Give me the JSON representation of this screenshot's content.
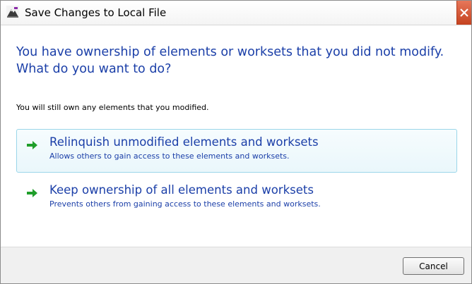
{
  "window": {
    "title": "Save Changes to Local File"
  },
  "main": {
    "instruction": "You have ownership of elements or worksets that you did not modify. What do you want to do?",
    "note": "You will still own any elements that you modified.",
    "options": [
      {
        "title": "Relinquish unmodified elements and worksets",
        "description": "Allows others to gain access to these elements and worksets."
      },
      {
        "title": "Keep ownership of all elements and worksets",
        "description": "Prevents others from gaining access to these elements and worksets."
      }
    ]
  },
  "footer": {
    "cancel_label": "Cancel"
  },
  "colors": {
    "instruction_text": "#1b3fa8",
    "arrow": "#1f9e2a",
    "highlight_border": "#9ad6e9",
    "close_button": "#d0502c"
  },
  "icons": {
    "app": "revit-app-icon",
    "close": "close-icon",
    "command_link": "green-arrow-icon"
  }
}
